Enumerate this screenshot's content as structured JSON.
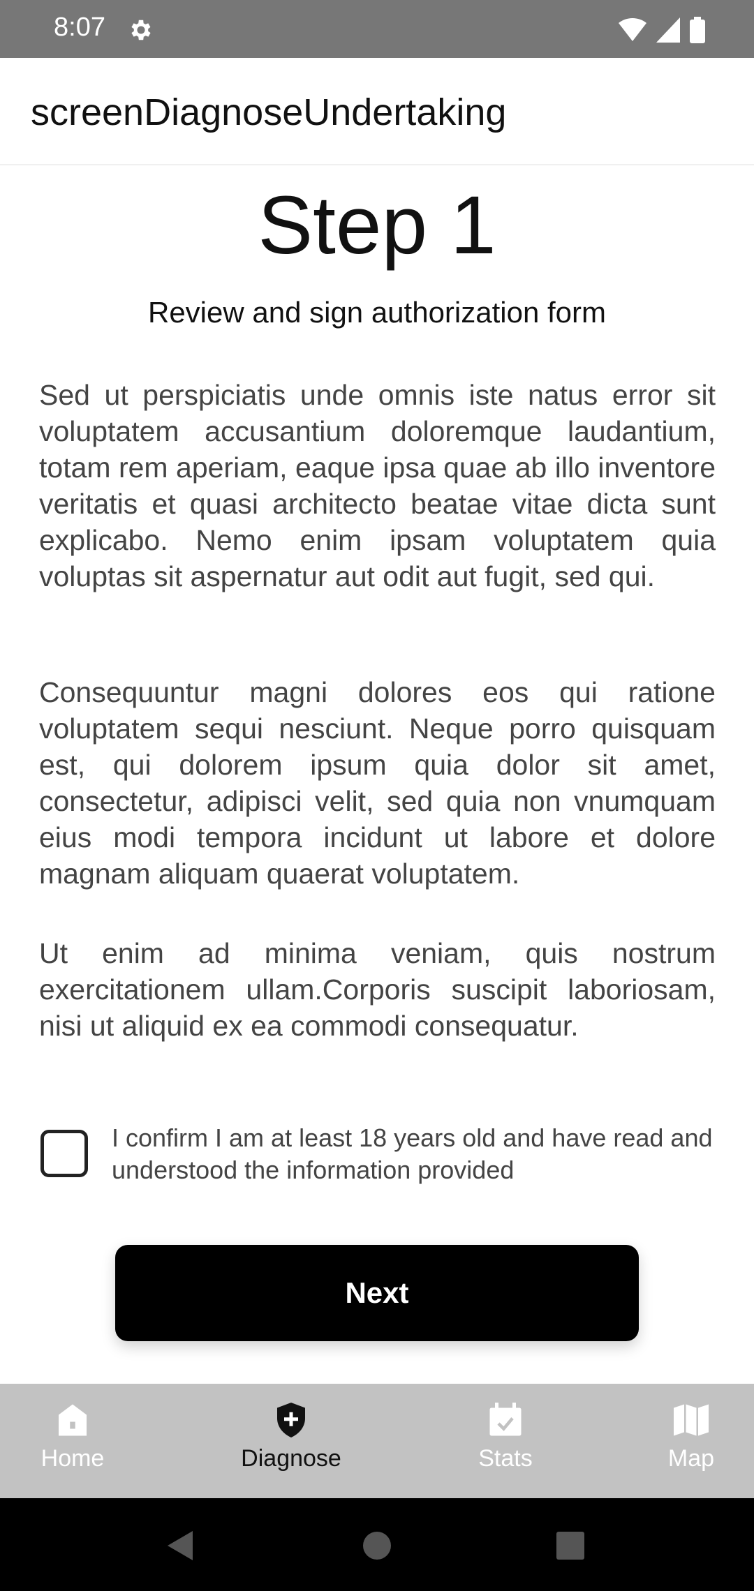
{
  "status_bar": {
    "time": "8:07",
    "icons": [
      "gear-icon",
      "wifi-icon",
      "signal-icon",
      "battery-icon"
    ]
  },
  "app_bar": {
    "title": "screenDiagnoseUndertaking"
  },
  "content": {
    "step_title": "Step 1",
    "subtitle": "Review and sign authorization form",
    "paragraphs": [
      "Sed ut perspiciatis unde omnis iste natus error sit voluptatem accusantium doloremque laudantium, totam rem aperiam, eaque ipsa quae ab illo inventore veritatis et quasi architecto beatae vitae dicta sunt explicabo. Nemo enim ipsam voluptatem quia voluptas sit aspernatur aut odit aut fugit, sed qui.",
      "Consequuntur magni dolores eos qui ratione voluptatem sequi nesciunt. Neque porro quisquam est, qui dolorem ipsum quia dolor sit amet, consectetur, adipisci velit, sed quia non vnumquam eius modi tempora incidunt ut labore et dolore magnam aliquam quaerat voluptatem.",
      "Ut enim ad minima veniam, quis nostrum exercitationem ullam.Corporis suscipit laboriosam, nisi ut aliquid ex ea commodi consequatur."
    ],
    "confirm_text": "I confirm I am at least 18 years old and have read and understood the information provided",
    "confirm_checked": false,
    "next_label": "Next"
  },
  "bottom_nav": {
    "items": [
      {
        "label": "Home",
        "icon": "home-icon",
        "active": false
      },
      {
        "label": "Diagnose",
        "icon": "shield-plus-icon",
        "active": true
      },
      {
        "label": "Stats",
        "icon": "calendar-check-icon",
        "active": false
      },
      {
        "label": "Map",
        "icon": "map-icon",
        "active": false
      }
    ]
  },
  "colors": {
    "status_bar": "#777777",
    "bottom_nav": "#c2c2c2",
    "button": "#000000",
    "nav_inactive": "#ffffff",
    "nav_active": "#111111"
  }
}
